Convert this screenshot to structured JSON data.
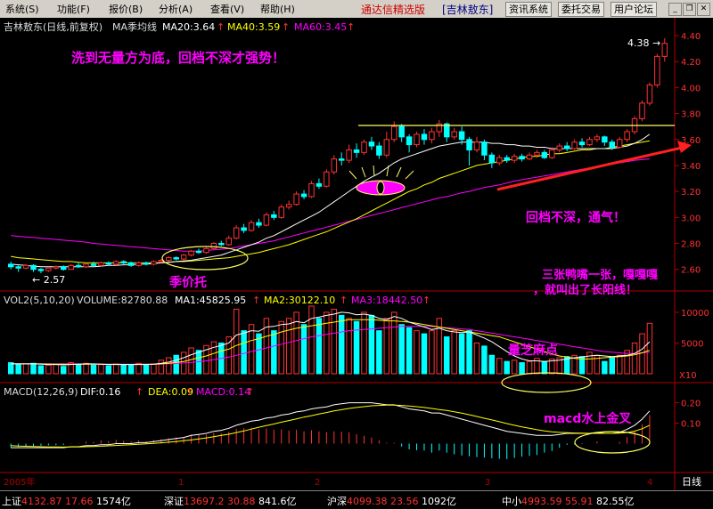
{
  "menu": [
    "系统(S)",
    "功能(F)",
    "报价(B)",
    "分析(A)",
    "查看(V)",
    "帮助(H)"
  ],
  "brand": "通达信精选版",
  "stock_code": "[吉林敖东]",
  "buttons": [
    "资讯系统",
    "委托交易",
    "用户论坛"
  ],
  "window_controls": [
    "minimize-icon",
    "restore-icon",
    "close-icon"
  ],
  "price_header": {
    "title": "吉林敖东(日线,前复权)",
    "ma_label": "MA季均线",
    "ma20": "MA20:3.64",
    "ma40": "MA40:3.59",
    "ma60": "MA60:3.45",
    "arrow": "↑"
  },
  "vol_header": {
    "label": "VOL2(5,10,20)",
    "volume": "VOLUME:82780.88",
    "ma1": "MA1:45825.95",
    "ma2": "MA2:30122.10",
    "ma3": "MA3:18442.50",
    "arrow": "↑"
  },
  "macd_header": {
    "label": "MACD(12,26,9)",
    "dif": "DIF:0.16",
    "dea": "DEA:0.09",
    "macd": "MACD:0.14",
    "arrow": "↑"
  },
  "annotations": {
    "top": "洗到无量方为底，回档不深才强势！",
    "price_support": "季价托",
    "pullback": "回档不深，通气！",
    "three_line": "三张鸭嘴一张，嘎嘎嘎",
    "three_line2": "，就叫出了长阳线！",
    "volume_note": "量芝麻点",
    "macd_note": "macd水上金叉",
    "low_label": "2.57",
    "high_label": "4.38"
  },
  "colors": {
    "up": "#ff3232",
    "down": "#00ffff",
    "ma20": "#ffffff",
    "ma40": "#ffff00",
    "ma60": "#ff00ff",
    "annotation": "#ff00ff",
    "ellipse": "#ffff66",
    "axis": "#b00000"
  },
  "status": [
    {
      "name": "上证",
      "value": "4132.87",
      "change": "17.66",
      "amount": "1574亿"
    },
    {
      "name": "深证",
      "value": "13697.2",
      "change": "30.88",
      "amount": "841.6亿"
    },
    {
      "name": "沪深",
      "value": "4099.38",
      "change": "23.56",
      "amount": "1092亿"
    },
    {
      "name": "中小",
      "value": "4993.59",
      "change": "55.91",
      "amount": "82.55亿"
    }
  ],
  "x_axis_labels": [
    "2005年",
    "1",
    "2",
    "3",
    "4"
  ],
  "period_label": "日线",
  "chart_data": {
    "type": "candlestick",
    "price_axis": {
      "ticks": [
        2.6,
        2.8,
        3.0,
        3.2,
        3.4,
        3.6,
        3.8,
        4.0,
        4.2,
        4.4
      ],
      "tick_labels": [
        "2.60",
        "2.80",
        "3.00",
        "3.20",
        "3.40",
        "3.60",
        "3.80",
        "4.00",
        "4.20",
        "4.40"
      ]
    },
    "volume_axis": {
      "ticks": [
        5000,
        10000
      ],
      "tick_labels": [
        "5000",
        "10000"
      ],
      "unit": "X10"
    },
    "macd_axis": {
      "ticks": [
        0.1,
        0.2
      ],
      "tick_labels": [
        "0.10",
        "0.20"
      ]
    },
    "candles": [
      {
        "o": 2.64,
        "c": 2.62,
        "h": 2.66,
        "l": 2.6
      },
      {
        "o": 2.62,
        "c": 2.61,
        "h": 2.63,
        "l": 2.58
      },
      {
        "o": 2.61,
        "c": 2.63,
        "h": 2.64,
        "l": 2.6
      },
      {
        "o": 2.63,
        "c": 2.6,
        "h": 2.64,
        "l": 2.58
      },
      {
        "o": 2.6,
        "c": 2.59,
        "h": 2.61,
        "l": 2.57
      },
      {
        "o": 2.59,
        "c": 2.61,
        "h": 2.62,
        "l": 2.58
      },
      {
        "o": 2.61,
        "c": 2.62,
        "h": 2.63,
        "l": 2.6
      },
      {
        "o": 2.62,
        "c": 2.6,
        "h": 2.63,
        "l": 2.59
      },
      {
        "o": 2.6,
        "c": 2.63,
        "h": 2.64,
        "l": 2.6
      },
      {
        "o": 2.63,
        "c": 2.62,
        "h": 2.65,
        "l": 2.61
      },
      {
        "o": 2.62,
        "c": 2.64,
        "h": 2.65,
        "l": 2.61
      },
      {
        "o": 2.64,
        "c": 2.63,
        "h": 2.66,
        "l": 2.62
      },
      {
        "o": 2.63,
        "c": 2.65,
        "h": 2.66,
        "l": 2.62
      },
      {
        "o": 2.65,
        "c": 2.64,
        "h": 2.66,
        "l": 2.63
      },
      {
        "o": 2.64,
        "c": 2.66,
        "h": 2.67,
        "l": 2.63
      },
      {
        "o": 2.66,
        "c": 2.65,
        "h": 2.67,
        "l": 2.64
      },
      {
        "o": 2.65,
        "c": 2.63,
        "h": 2.66,
        "l": 2.62
      },
      {
        "o": 2.63,
        "c": 2.65,
        "h": 2.66,
        "l": 2.62
      },
      {
        "o": 2.65,
        "c": 2.64,
        "h": 2.66,
        "l": 2.63
      },
      {
        "o": 2.64,
        "c": 2.66,
        "h": 2.67,
        "l": 2.63
      },
      {
        "o": 2.66,
        "c": 2.67,
        "h": 2.68,
        "l": 2.65
      },
      {
        "o": 2.67,
        "c": 2.69,
        "h": 2.7,
        "l": 2.66
      },
      {
        "o": 2.69,
        "c": 2.68,
        "h": 2.7,
        "l": 2.67
      },
      {
        "o": 2.68,
        "c": 2.71,
        "h": 2.72,
        "l": 2.67
      },
      {
        "o": 2.71,
        "c": 2.74,
        "h": 2.75,
        "l": 2.7
      },
      {
        "o": 2.74,
        "c": 2.73,
        "h": 2.76,
        "l": 2.72
      },
      {
        "o": 2.73,
        "c": 2.76,
        "h": 2.77,
        "l": 2.72
      },
      {
        "o": 2.76,
        "c": 2.8,
        "h": 2.81,
        "l": 2.75
      },
      {
        "o": 2.8,
        "c": 2.79,
        "h": 2.82,
        "l": 2.78
      },
      {
        "o": 2.79,
        "c": 2.84,
        "h": 2.86,
        "l": 2.78
      },
      {
        "o": 2.84,
        "c": 2.92,
        "h": 2.94,
        "l": 2.83
      },
      {
        "o": 2.92,
        "c": 2.9,
        "h": 2.95,
        "l": 2.88
      },
      {
        "o": 2.9,
        "c": 2.96,
        "h": 2.98,
        "l": 2.89
      },
      {
        "o": 2.96,
        "c": 2.94,
        "h": 2.99,
        "l": 2.92
      },
      {
        "o": 2.94,
        "c": 3.02,
        "h": 3.04,
        "l": 2.93
      },
      {
        "o": 3.02,
        "c": 3.0,
        "h": 3.05,
        "l": 2.98
      },
      {
        "o": 3.0,
        "c": 3.08,
        "h": 3.1,
        "l": 2.99
      },
      {
        "o": 3.08,
        "c": 3.1,
        "h": 3.13,
        "l": 3.06
      },
      {
        "o": 3.1,
        "c": 3.18,
        "h": 3.2,
        "l": 3.09
      },
      {
        "o": 3.18,
        "c": 3.16,
        "h": 3.21,
        "l": 3.14
      },
      {
        "o": 3.16,
        "c": 3.26,
        "h": 3.28,
        "l": 3.15
      },
      {
        "o": 3.26,
        "c": 3.24,
        "h": 3.3,
        "l": 3.22
      },
      {
        "o": 3.24,
        "c": 3.35,
        "h": 3.37,
        "l": 3.23
      },
      {
        "o": 3.35,
        "c": 3.45,
        "h": 3.48,
        "l": 3.33
      },
      {
        "o": 3.45,
        "c": 3.44,
        "h": 3.5,
        "l": 3.4
      },
      {
        "o": 3.44,
        "c": 3.52,
        "h": 3.56,
        "l": 3.42
      },
      {
        "o": 3.52,
        "c": 3.5,
        "h": 3.57,
        "l": 3.46
      },
      {
        "o": 3.5,
        "c": 3.58,
        "h": 3.6,
        "l": 3.48
      },
      {
        "o": 3.58,
        "c": 3.55,
        "h": 3.62,
        "l": 3.52
      },
      {
        "o": 3.55,
        "c": 3.48,
        "h": 3.58,
        "l": 3.45
      },
      {
        "o": 3.48,
        "c": 3.6,
        "h": 3.66,
        "l": 3.46
      },
      {
        "o": 3.6,
        "c": 3.7,
        "h": 3.74,
        "l": 3.58
      },
      {
        "o": 3.7,
        "c": 3.62,
        "h": 3.72,
        "l": 3.58
      },
      {
        "o": 3.62,
        "c": 3.56,
        "h": 3.64,
        "l": 3.5
      },
      {
        "o": 3.56,
        "c": 3.64,
        "h": 3.66,
        "l": 3.54
      },
      {
        "o": 3.64,
        "c": 3.6,
        "h": 3.68,
        "l": 3.56
      },
      {
        "o": 3.6,
        "c": 3.66,
        "h": 3.69,
        "l": 3.57
      },
      {
        "o": 3.66,
        "c": 3.72,
        "h": 3.75,
        "l": 3.62
      },
      {
        "o": 3.72,
        "c": 3.62,
        "h": 3.73,
        "l": 3.58
      },
      {
        "o": 3.62,
        "c": 3.66,
        "h": 3.69,
        "l": 3.6
      },
      {
        "o": 3.66,
        "c": 3.6,
        "h": 3.7,
        "l": 3.56
      },
      {
        "o": 3.6,
        "c": 3.52,
        "h": 3.62,
        "l": 3.4
      },
      {
        "o": 3.52,
        "c": 3.58,
        "h": 3.62,
        "l": 3.5
      },
      {
        "o": 3.58,
        "c": 3.48,
        "h": 3.6,
        "l": 3.44
      },
      {
        "o": 3.48,
        "c": 3.42,
        "h": 3.5,
        "l": 3.38
      },
      {
        "o": 3.42,
        "c": 3.46,
        "h": 3.48,
        "l": 3.4
      },
      {
        "o": 3.46,
        "c": 3.44,
        "h": 3.48,
        "l": 3.42
      },
      {
        "o": 3.44,
        "c": 3.47,
        "h": 3.49,
        "l": 3.42
      },
      {
        "o": 3.47,
        "c": 3.45,
        "h": 3.49,
        "l": 3.43
      },
      {
        "o": 3.45,
        "c": 3.48,
        "h": 3.5,
        "l": 3.44
      },
      {
        "o": 3.48,
        "c": 3.5,
        "h": 3.52,
        "l": 3.46
      },
      {
        "o": 3.5,
        "c": 3.46,
        "h": 3.52,
        "l": 3.45
      },
      {
        "o": 3.46,
        "c": 3.52,
        "h": 3.54,
        "l": 3.45
      },
      {
        "o": 3.52,
        "c": 3.55,
        "h": 3.57,
        "l": 3.5
      },
      {
        "o": 3.55,
        "c": 3.53,
        "h": 3.58,
        "l": 3.51
      },
      {
        "o": 3.53,
        "c": 3.58,
        "h": 3.6,
        "l": 3.52
      },
      {
        "o": 3.58,
        "c": 3.56,
        "h": 3.61,
        "l": 3.54
      },
      {
        "o": 3.56,
        "c": 3.6,
        "h": 3.62,
        "l": 3.55
      },
      {
        "o": 3.6,
        "c": 3.62,
        "h": 3.64,
        "l": 3.58
      },
      {
        "o": 3.62,
        "c": 3.58,
        "h": 3.63,
        "l": 3.55
      },
      {
        "o": 3.58,
        "c": 3.54,
        "h": 3.6,
        "l": 3.52
      },
      {
        "o": 3.54,
        "c": 3.6,
        "h": 3.62,
        "l": 3.53
      },
      {
        "o": 3.6,
        "c": 3.66,
        "h": 3.68,
        "l": 3.58
      },
      {
        "o": 3.66,
        "c": 3.76,
        "h": 3.78,
        "l": 3.64
      },
      {
        "o": 3.76,
        "c": 3.88,
        "h": 3.9,
        "l": 3.74
      },
      {
        "o": 3.88,
        "c": 4.02,
        "h": 4.04,
        "l": 3.86
      },
      {
        "o": 4.02,
        "c": 4.24,
        "h": 4.26,
        "l": 4.0
      },
      {
        "o": 4.24,
        "c": 4.34,
        "h": 4.38,
        "l": 4.2
      }
    ],
    "volume": [
      180,
      150,
      160,
      170,
      130,
      140,
      150,
      120,
      180,
      160,
      170,
      140,
      150,
      130,
      160,
      150,
      140,
      170,
      150,
      160,
      220,
      260,
      300,
      350,
      420,
      380,
      460,
      520,
      500,
      600,
      1050,
      700,
      800,
      650,
      900,
      700,
      850,
      900,
      1000,
      800,
      1100,
      900,
      1000,
      1050,
      950,
      900,
      850,
      1000,
      950,
      700,
      900,
      1000,
      800,
      750,
      700,
      650,
      700,
      900,
      600,
      700,
      650,
      700,
      500,
      450,
      300,
      250,
      200,
      220,
      180,
      200,
      250,
      200,
      240,
      260,
      280,
      300,
      280,
      350,
      300,
      200,
      260,
      300,
      380,
      500,
      650,
      820
    ],
    "dif": [
      -0.02,
      -0.02,
      -0.02,
      -0.02,
      -0.02,
      -0.02,
      -0.02,
      -0.02,
      -0.015,
      -0.015,
      -0.01,
      -0.01,
      -0.005,
      -0.005,
      0,
      0,
      0,
      0.005,
      0.005,
      0.01,
      0.015,
      0.02,
      0.025,
      0.03,
      0.04,
      0.045,
      0.05,
      0.06,
      0.065,
      0.075,
      0.09,
      0.1,
      0.11,
      0.115,
      0.125,
      0.13,
      0.14,
      0.145,
      0.155,
      0.16,
      0.17,
      0.175,
      0.18,
      0.19,
      0.195,
      0.2,
      0.2,
      0.2,
      0.2,
      0.195,
      0.19,
      0.19,
      0.18,
      0.17,
      0.165,
      0.16,
      0.15,
      0.15,
      0.14,
      0.13,
      0.12,
      0.11,
      0.1,
      0.09,
      0.08,
      0.07,
      0.06,
      0.055,
      0.05,
      0.045,
      0.04,
      0.04,
      0.04,
      0.045,
      0.05,
      0.05,
      0.05,
      0.05,
      0.055,
      0.05,
      0.05,
      0.055,
      0.07,
      0.09,
      0.12,
      0.16
    ],
    "dea": [
      -0.01,
      -0.012,
      -0.013,
      -0.014,
      -0.015,
      -0.016,
      -0.016,
      -0.017,
      -0.016,
      -0.016,
      -0.015,
      -0.014,
      -0.013,
      -0.011,
      -0.009,
      -0.007,
      -0.005,
      -0.003,
      -0.001,
      0.001,
      0.004,
      0.007,
      0.01,
      0.014,
      0.018,
      0.023,
      0.028,
      0.034,
      0.04,
      0.046,
      0.054,
      0.062,
      0.071,
      0.08,
      0.088,
      0.096,
      0.105,
      0.113,
      0.121,
      0.13,
      0.137,
      0.145,
      0.152,
      0.16,
      0.166,
      0.172,
      0.177,
      0.181,
      0.185,
      0.187,
      0.188,
      0.188,
      0.187,
      0.184,
      0.181,
      0.177,
      0.172,
      0.167,
      0.162,
      0.156,
      0.149,
      0.141,
      0.133,
      0.124,
      0.116,
      0.107,
      0.098,
      0.09,
      0.082,
      0.075,
      0.068,
      0.062,
      0.058,
      0.055,
      0.053,
      0.052,
      0.051,
      0.05,
      0.05,
      0.05,
      0.05,
      0.051,
      0.054,
      0.061,
      0.073,
      0.09
    ],
    "ma20": [
      2.64,
      2.635,
      2.63,
      2.625,
      2.62,
      2.62,
      2.62,
      2.62,
      2.62,
      2.62,
      2.62,
      2.62,
      2.625,
      2.63,
      2.63,
      2.635,
      2.635,
      2.64,
      2.64,
      2.645,
      2.65,
      2.655,
      2.66,
      2.665,
      2.67,
      2.68,
      2.69,
      2.7,
      2.71,
      2.73,
      2.75,
      2.77,
      2.79,
      2.81,
      2.84,
      2.86,
      2.89,
      2.92,
      2.95,
      2.98,
      3.01,
      3.04,
      3.08,
      3.12,
      3.16,
      3.2,
      3.24,
      3.28,
      3.31,
      3.34,
      3.38,
      3.42,
      3.45,
      3.47,
      3.49,
      3.51,
      3.53,
      3.55,
      3.56,
      3.57,
      3.58,
      3.58,
      3.58,
      3.58,
      3.57,
      3.57,
      3.56,
      3.56,
      3.55,
      3.55,
      3.54,
      3.54,
      3.53,
      3.53,
      3.53,
      3.53,
      3.53,
      3.53,
      3.53,
      3.53,
      3.53,
      3.54,
      3.55,
      3.57,
      3.6,
      3.64
    ],
    "ma40": [
      2.7,
      2.69,
      2.685,
      2.68,
      2.675,
      2.67,
      2.665,
      2.66,
      2.66,
      2.655,
      2.65,
      2.65,
      2.65,
      2.65,
      2.65,
      2.65,
      2.65,
      2.65,
      2.65,
      2.65,
      2.65,
      2.655,
      2.66,
      2.66,
      2.665,
      2.67,
      2.675,
      2.68,
      2.685,
      2.69,
      2.7,
      2.71,
      2.72,
      2.73,
      2.745,
      2.76,
      2.775,
      2.79,
      2.81,
      2.83,
      2.85,
      2.87,
      2.89,
      2.915,
      2.94,
      2.965,
      2.99,
      3.02,
      3.05,
      3.08,
      3.11,
      3.14,
      3.17,
      3.2,
      3.22,
      3.25,
      3.27,
      3.3,
      3.32,
      3.34,
      3.36,
      3.38,
      3.4,
      3.41,
      3.42,
      3.43,
      3.44,
      3.45,
      3.46,
      3.47,
      3.47,
      3.48,
      3.49,
      3.49,
      3.5,
      3.51,
      3.52,
      3.52,
      3.53,
      3.53,
      3.54,
      3.55,
      3.56,
      3.57,
      3.58,
      3.59
    ],
    "ma60": [
      2.86,
      2.855,
      2.85,
      2.845,
      2.84,
      2.835,
      2.83,
      2.825,
      2.82,
      2.815,
      2.81,
      2.8,
      2.795,
      2.79,
      2.785,
      2.78,
      2.775,
      2.77,
      2.765,
      2.76,
      2.755,
      2.75,
      2.745,
      2.74,
      2.74,
      2.74,
      2.745,
      2.75,
      2.755,
      2.76,
      2.77,
      2.78,
      2.79,
      2.8,
      2.81,
      2.82,
      2.835,
      2.85,
      2.865,
      2.88,
      2.895,
      2.91,
      2.925,
      2.94,
      2.955,
      2.97,
      2.985,
      3.0,
      3.015,
      3.03,
      3.045,
      3.06,
      3.075,
      3.09,
      3.105,
      3.12,
      3.135,
      3.15,
      3.16,
      3.175,
      3.19,
      3.2,
      3.215,
      3.23,
      3.24,
      3.25,
      3.265,
      3.28,
      3.29,
      3.3,
      3.31,
      3.32,
      3.33,
      3.34,
      3.35,
      3.36,
      3.37,
      3.38,
      3.39,
      3.4,
      3.41,
      3.42,
      3.43,
      3.44,
      3.445,
      3.45
    ],
    "vol_ma1": [
      160,
      160,
      160,
      160,
      155,
      150,
      150,
      145,
      150,
      155,
      160,
      160,
      155,
      150,
      150,
      150,
      150,
      150,
      150,
      155,
      170,
      190,
      220,
      260,
      310,
      350,
      390,
      430,
      460,
      500,
      630,
      660,
      700,
      690,
      760,
      770,
      800,
      810,
      850,
      830,
      900,
      920,
      950,
      970,
      1000,
      990,
      960,
      970,
      950,
      900,
      880,
      930,
      900,
      840,
      800,
      760,
      720,
      740,
      700,
      680,
      670,
      680,
      630,
      580,
      520,
      440,
      360,
      290,
      240,
      210,
      210,
      200,
      210,
      220,
      240,
      260,
      270,
      290,
      300,
      290,
      280,
      290,
      300,
      330,
      400,
      520
    ],
    "vol_ma2": [
      160,
      160,
      160,
      160,
      160,
      158,
      156,
      155,
      154,
      154,
      155,
      155,
      155,
      154,
      153,
      152,
      152,
      153,
      153,
      154,
      160,
      170,
      185,
      200,
      230,
      260,
      290,
      330,
      370,
      400,
      460,
      500,
      540,
      570,
      610,
      640,
      680,
      710,
      740,
      760,
      780,
      800,
      820,
      840,
      860,
      880,
      880,
      880,
      880,
      870,
      860,
      860,
      850,
      840,
      820,
      800,
      780,
      760,
      740,
      720,
      700,
      680,
      660,
      640,
      620,
      600,
      560,
      520,
      480,
      440,
      400,
      360,
      320,
      290,
      270,
      250,
      240,
      240,
      250,
      260,
      270,
      280,
      290,
      310,
      340,
      380
    ],
    "vol_ma3": [
      160,
      160,
      160,
      160,
      160,
      160,
      160,
      160,
      160,
      160,
      158,
      158,
      157,
      157,
      156,
      156,
      156,
      156,
      156,
      156,
      158,
      162,
      168,
      175,
      185,
      195,
      210,
      230,
      250,
      270,
      300,
      330,
      360,
      390,
      420,
      450,
      480,
      510,
      540,
      570,
      600,
      620,
      640,
      660,
      680,
      700,
      710,
      720,
      730,
      740,
      750,
      760,
      770,
      770,
      770,
      770,
      770,
      760,
      750,
      740,
      730,
      720,
      700,
      680,
      660,
      640,
      620,
      600,
      580,
      560,
      540,
      520,
      500,
      480,
      460,
      440,
      420,
      400,
      380,
      360,
      350,
      340,
      330,
      330,
      340,
      350
    ]
  }
}
